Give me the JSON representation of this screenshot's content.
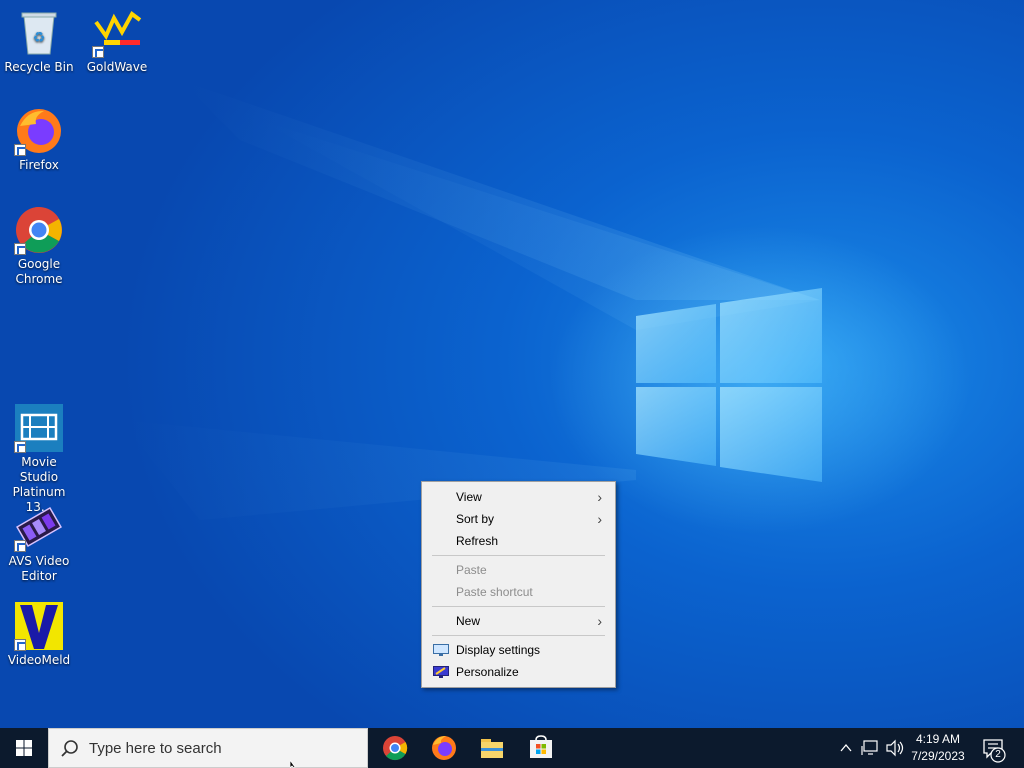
{
  "desktop": {
    "icons": [
      {
        "label": "Recycle Bin",
        "icon": "recycle-bin-icon"
      },
      {
        "label": "GoldWave",
        "icon": "goldwave-icon"
      },
      {
        "label": "Firefox",
        "icon": "firefox-icon"
      },
      {
        "label": "Google Chrome",
        "icon": "chrome-icon"
      },
      {
        "label": "Movie Studio Platinum 13...",
        "icon": "movie-studio-icon"
      },
      {
        "label": "AVS Video Editor",
        "icon": "avs-video-editor-icon"
      },
      {
        "label": "VideoMeld",
        "icon": "videomeld-icon"
      }
    ]
  },
  "context_menu": {
    "items": [
      {
        "label": "View",
        "submenu": true,
        "enabled": true
      },
      {
        "label": "Sort by",
        "submenu": true,
        "enabled": true
      },
      {
        "label": "Refresh",
        "submenu": false,
        "enabled": true
      },
      {
        "label": "Paste",
        "submenu": false,
        "enabled": false
      },
      {
        "label": "Paste shortcut",
        "submenu": false,
        "enabled": false
      },
      {
        "label": "New",
        "submenu": true,
        "enabled": true
      },
      {
        "label": "Display settings",
        "submenu": false,
        "enabled": true,
        "icon": "display-settings-icon"
      },
      {
        "label": "Personalize",
        "submenu": false,
        "enabled": true,
        "icon": "personalize-icon"
      }
    ]
  },
  "taskbar": {
    "search_placeholder": "Type here to search",
    "pinned_apps": [
      "chrome-icon",
      "firefox-icon",
      "file-explorer-icon",
      "microsoft-store-icon"
    ],
    "tray_icons": [
      "show-hidden-icons-icon",
      "network-icon",
      "volume-icon"
    ],
    "clock": {
      "time": "4:19 AM",
      "date": "7/29/2023"
    },
    "notification_count": "2"
  },
  "colors": {
    "desktop_blue": "#0b63cf",
    "taskbar": "#0c1a2d",
    "menu_bg": "#f0f0f0"
  }
}
